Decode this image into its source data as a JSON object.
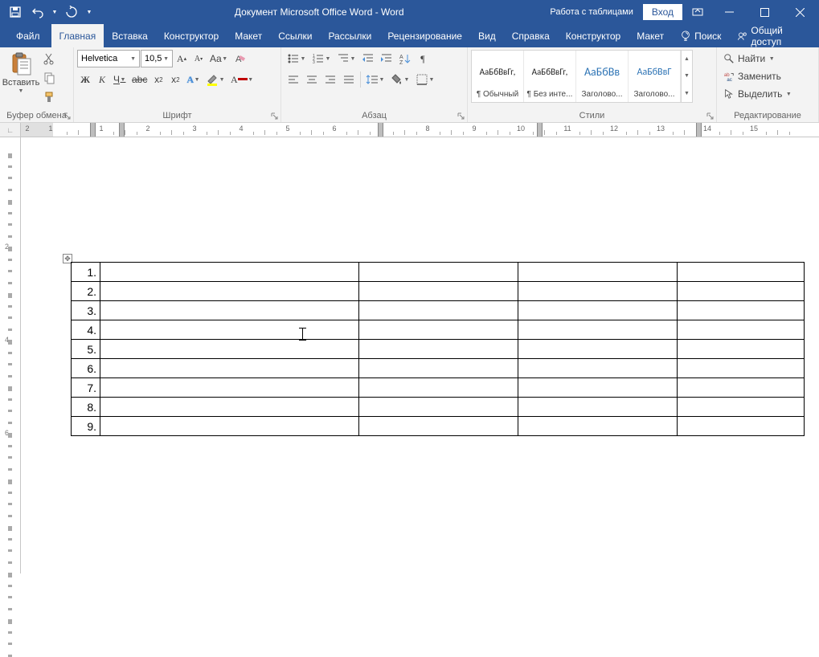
{
  "titlebar": {
    "doc_title": "Документ Microsoft Office Word  -  Word",
    "table_tools": "Работа с таблицами",
    "login": "Вход"
  },
  "tabs": {
    "file": "Файл",
    "home": "Главная",
    "insert": "Вставка",
    "design": "Конструктор",
    "layout": "Макет",
    "references": "Ссылки",
    "mailings": "Рассылки",
    "review": "Рецензирование",
    "view": "Вид",
    "help": "Справка",
    "tbl_design": "Конструктор",
    "tbl_layout": "Макет",
    "search": "Поиск",
    "share": "Общий доступ"
  },
  "ribbon": {
    "clipboard": {
      "label": "Буфер обмена",
      "paste": "Вставить"
    },
    "font": {
      "label": "Шрифт",
      "name": "Helvetica",
      "size": "10,5",
      "bold": "Ж",
      "italic": "К",
      "underline": "Ч",
      "strike": "abc",
      "sub": "x",
      "sup": "x",
      "case": "Aa",
      "clear": "A"
    },
    "paragraph": {
      "label": "Абзац"
    },
    "styles": {
      "label": "Стили",
      "items": [
        {
          "preview": "АаБбВвГг,",
          "name": "¶ Обычный",
          "cls": ""
        },
        {
          "preview": "АаБбВвГг,",
          "name": "¶ Без инте...",
          "cls": ""
        },
        {
          "preview": "АаБбВв",
          "name": "Заголово...",
          "cls": "heading1"
        },
        {
          "preview": "АаБбВвГ",
          "name": "Заголово...",
          "cls": "heading2"
        }
      ]
    },
    "editing": {
      "label": "Редактирование",
      "find": "Найти",
      "replace": "Заменить",
      "select": "Выделить"
    }
  },
  "table": {
    "rows": [
      {
        "n": "1."
      },
      {
        "n": "2."
      },
      {
        "n": "3."
      },
      {
        "n": "4."
      },
      {
        "n": "5."
      },
      {
        "n": "6."
      },
      {
        "n": "7."
      },
      {
        "n": "8."
      },
      {
        "n": "9."
      }
    ]
  },
  "ruler": {
    "h_labels": [
      "1",
      "2",
      "1",
      "2",
      "3",
      "4",
      "5",
      "6",
      "7",
      "8",
      "9",
      "10",
      "11",
      "12",
      "13",
      "14",
      "15"
    ],
    "v_labels": [
      "2",
      "4",
      "6"
    ]
  }
}
